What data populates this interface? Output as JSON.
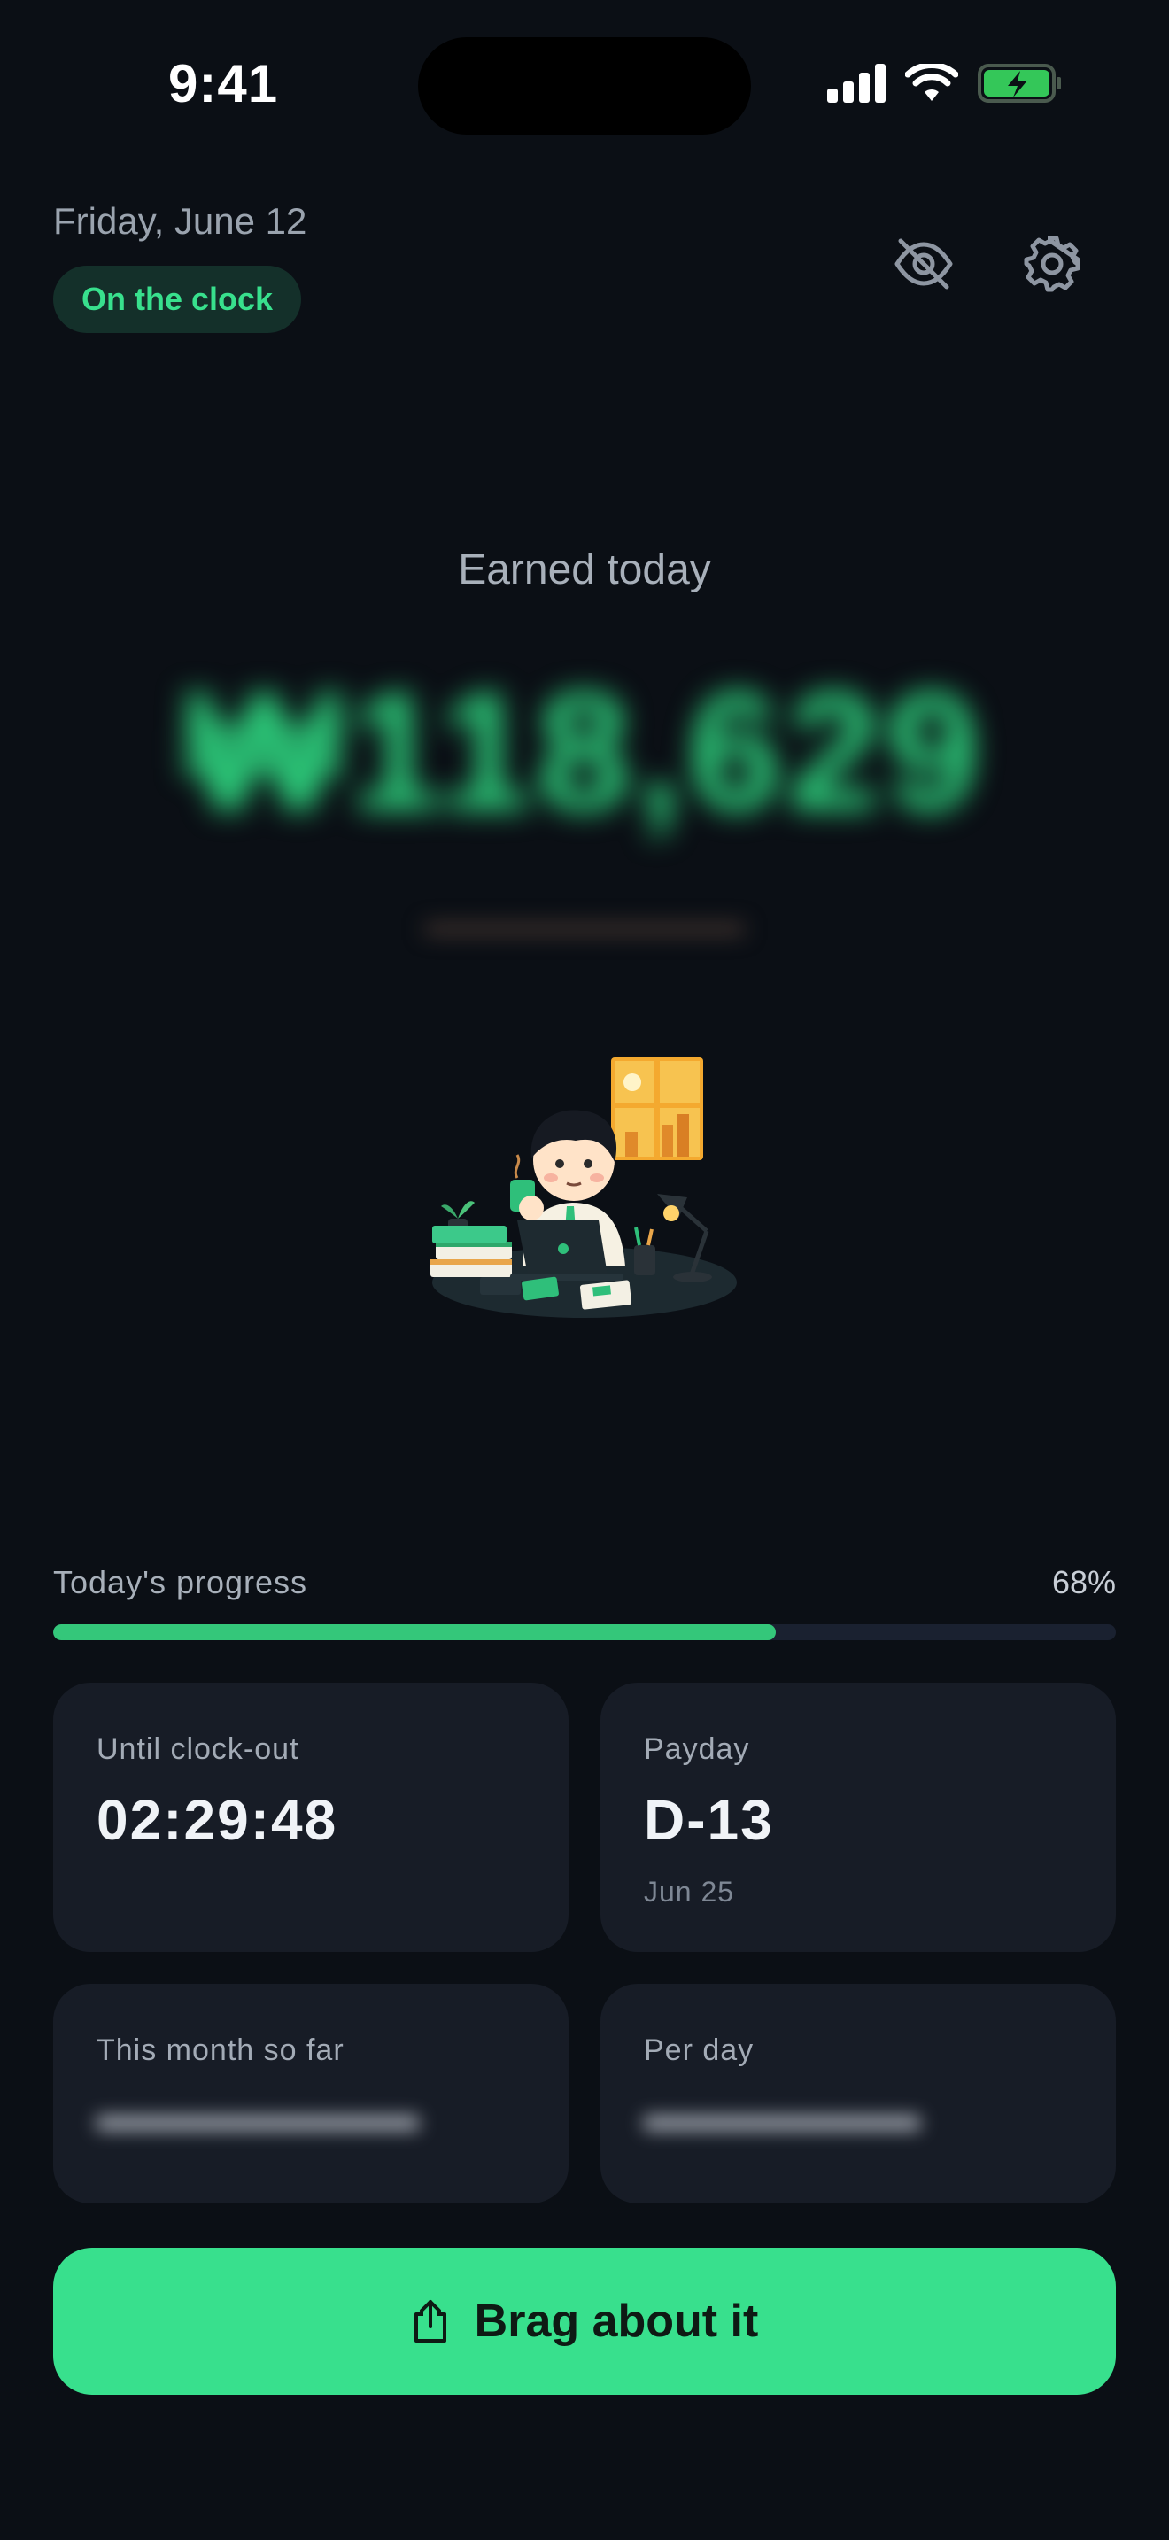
{
  "status_bar": {
    "time": "9:41"
  },
  "header": {
    "date": "Friday, June 12",
    "status_badge": "On the clock",
    "hide_icon": "eye-off-icon",
    "settings_icon": "gear-icon"
  },
  "earned": {
    "label": "Earned today",
    "amount": "₩118,629",
    "amount_hidden": true,
    "sub_hidden": true
  },
  "progress": {
    "label": "Today's progress",
    "percent_text": "68%",
    "value": 0.68
  },
  "cards": {
    "until_clock_out": {
      "label": "Until clock-out",
      "value": "02:29:48"
    },
    "payday": {
      "label": "Payday",
      "value": "D-13",
      "sub": "Jun 25"
    },
    "month_so_far": {
      "label": "This month so far",
      "value_hidden": true
    },
    "per_day": {
      "label": "Per day",
      "value_hidden": true
    }
  },
  "cta": {
    "label": "Brag about it",
    "icon": "share-icon"
  },
  "colors": {
    "background": "#0b0f15",
    "accent": "#38e08d",
    "card": "#171c26",
    "badge_bg": "#14302a"
  }
}
